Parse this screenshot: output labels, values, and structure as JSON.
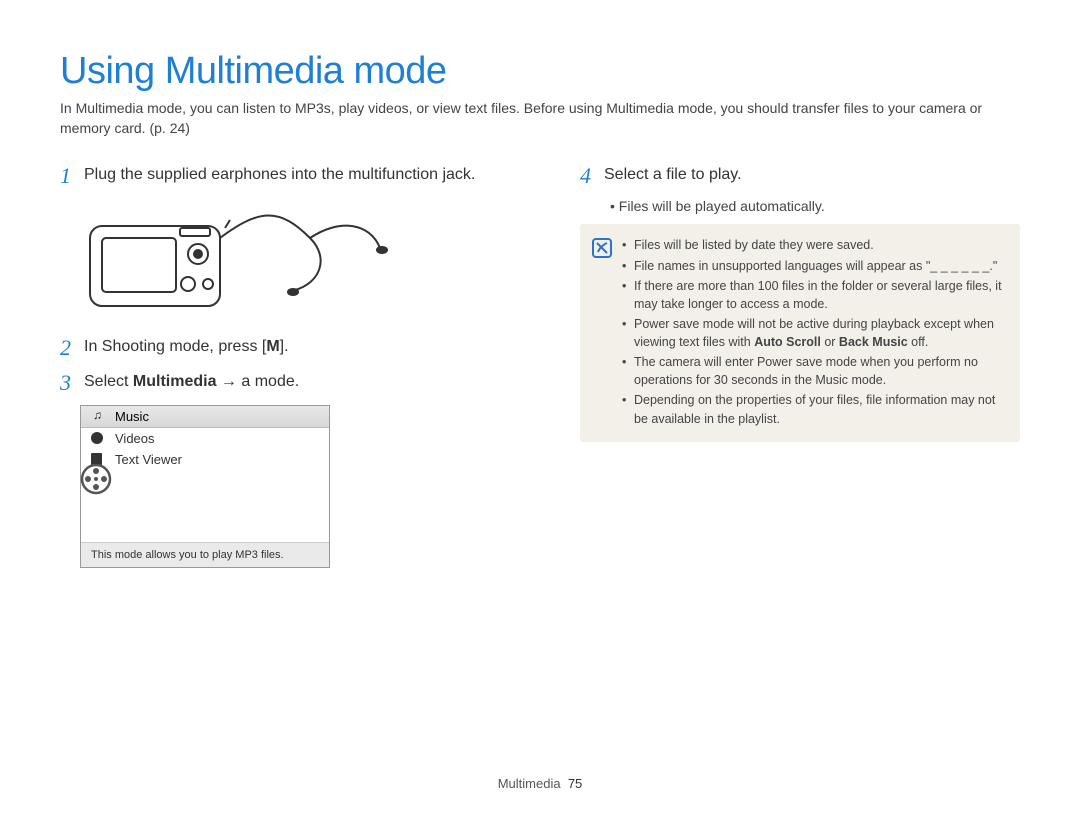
{
  "title": "Using Multimedia mode",
  "intro": "In Multimedia mode, you can listen to MP3s, play videos, or view text files. Before using Multimedia mode, you should transfer files to your camera or memory card. (p. 24)",
  "steps": {
    "s1": {
      "num": "1",
      "text": "Plug the supplied earphones into the multifunction jack."
    },
    "s2": {
      "num": "2",
      "prefix": "In Shooting mode, press [",
      "bold": "M",
      "suffix": "]."
    },
    "s3": {
      "num": "3",
      "prefix": "Select ",
      "bold": "Multimedia",
      "suffix": " → a mode."
    },
    "s4": {
      "num": "4",
      "text": "Select a file to play."
    }
  },
  "menu": {
    "items": [
      "Music",
      "Videos",
      "Text Viewer"
    ],
    "caption": "This mode allows you to play MP3 files."
  },
  "sub_bullet": "Files will be played automatically.",
  "notes": [
    "Files will be listed by date they were saved.",
    "File names in unsupported languages will appear as \"_ _ _ _ _ _.\"",
    "If there are more than 100 files in the folder or several large files, it may take longer to access a mode.",
    {
      "pre": "Power save mode will not be active during playback except when viewing text files with ",
      "b1": "Auto Scroll",
      "mid": " or ",
      "b2": "Back Music",
      "post": " off."
    },
    "The camera will enter Power save mode when you perform no operations for 30 seconds in the Music mode.",
    "Depending on the properties of your files, file information may not be available in the playlist."
  ],
  "footer": {
    "section": "Multimedia",
    "page": "75"
  }
}
